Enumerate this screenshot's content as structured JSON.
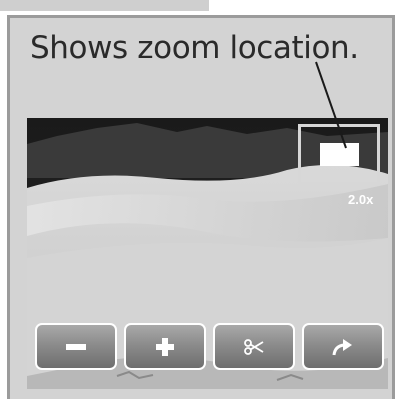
{
  "caption": "Shows zoom location.",
  "zoom": {
    "level_label": "2.0x"
  },
  "toolbar": {
    "buttons": [
      {
        "icon": "minus-icon"
      },
      {
        "icon": "plus-icon"
      },
      {
        "icon": "scissors-icon"
      },
      {
        "icon": "arrow-curve-icon"
      }
    ]
  }
}
